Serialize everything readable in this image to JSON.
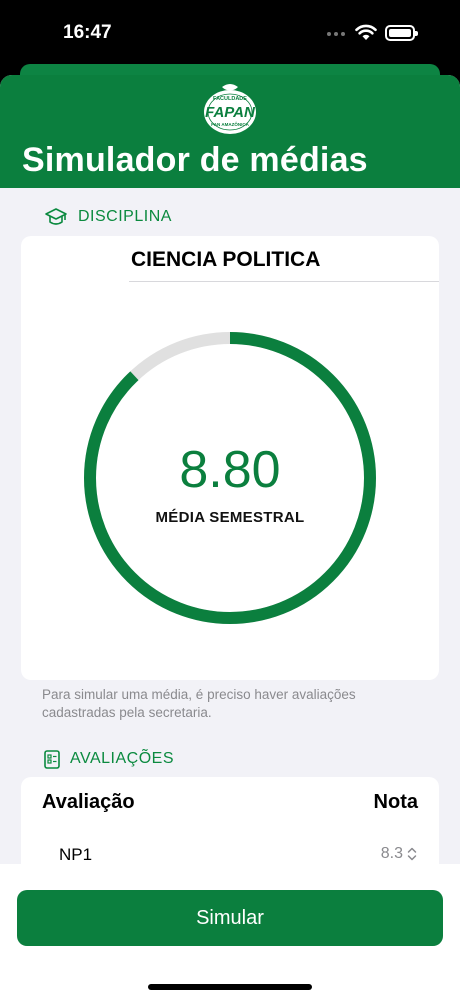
{
  "status_bar": {
    "time": "16:47"
  },
  "header": {
    "logo_top_text": "FACULDADE",
    "logo_text": "FAPAN",
    "logo_bottom_text": "PAN AMAZÔNICA",
    "title": "Simulador de médias"
  },
  "discipline_section": {
    "label": "DISCIPLINA",
    "icon": "graduation-cap-icon",
    "name": "CIENCIA POLITICA"
  },
  "gauge": {
    "value": "8.80",
    "label": "MÉDIA SEMESTRAL",
    "fraction": 0.88,
    "color": "#0b7f3e",
    "track_color": "#e0e0e0"
  },
  "footnote": "Para simular uma média, é preciso haver avaliações cadastradas pela secretaria.",
  "evaluations_section": {
    "label": "AVALIAÇÕES",
    "icon": "clipboard-icon",
    "columns": [
      "Avaliação",
      "Nota"
    ],
    "rows": [
      {
        "name": "NP1",
        "grade": "8.3"
      }
    ]
  },
  "actions": {
    "simulate": "Simular"
  },
  "colors": {
    "brand_green": "#0b7f3e",
    "section_green": "#0b8a3f",
    "background": "#f2f2f7"
  }
}
